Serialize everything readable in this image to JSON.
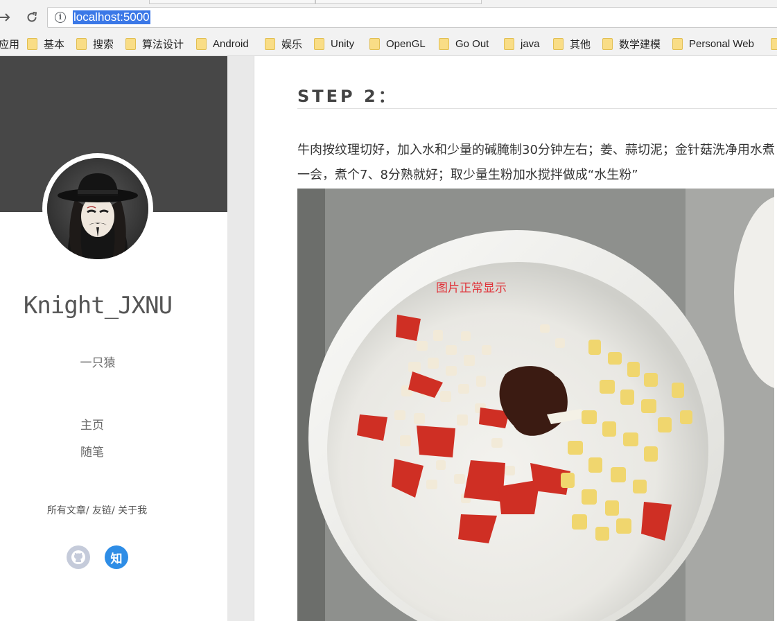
{
  "browser": {
    "url": "localhost:5000",
    "nav_back_icon": "arrow-right-icon",
    "reload_icon": "reload-icon"
  },
  "bookmarks": {
    "apps_label": "应用",
    "items": [
      "基本",
      "搜索",
      "算法设计",
      "Android",
      "娱乐",
      "Unity",
      "OpenGL",
      "Go Out",
      "java",
      "其他",
      "数学建模",
      "Personal Web"
    ]
  },
  "sidebar": {
    "site_name": "Knight_JXNU",
    "tagline": "一只猿",
    "nav": [
      "主页",
      "随笔"
    ],
    "footer_links": [
      "所有文章",
      "友链",
      "关于我"
    ],
    "social": {
      "github_icon": "github-icon",
      "zhihu_label": "知"
    },
    "colors": {
      "banner": "#474747",
      "zhihu": "#2e8de6",
      "github": "#c5cbda"
    }
  },
  "article": {
    "step_title": "STEP 2：",
    "paragraph": "牛肉按纹理切好，加入水和少量的碱腌制30分钟左右；姜、蒜切泥；金针菇洗净用水煮一会，煮个7、8分熟就好；取少量生粉加水搅拌做成“水生粉”",
    "image_caption": "图片正常显示",
    "caption_color": "#e0333a"
  }
}
